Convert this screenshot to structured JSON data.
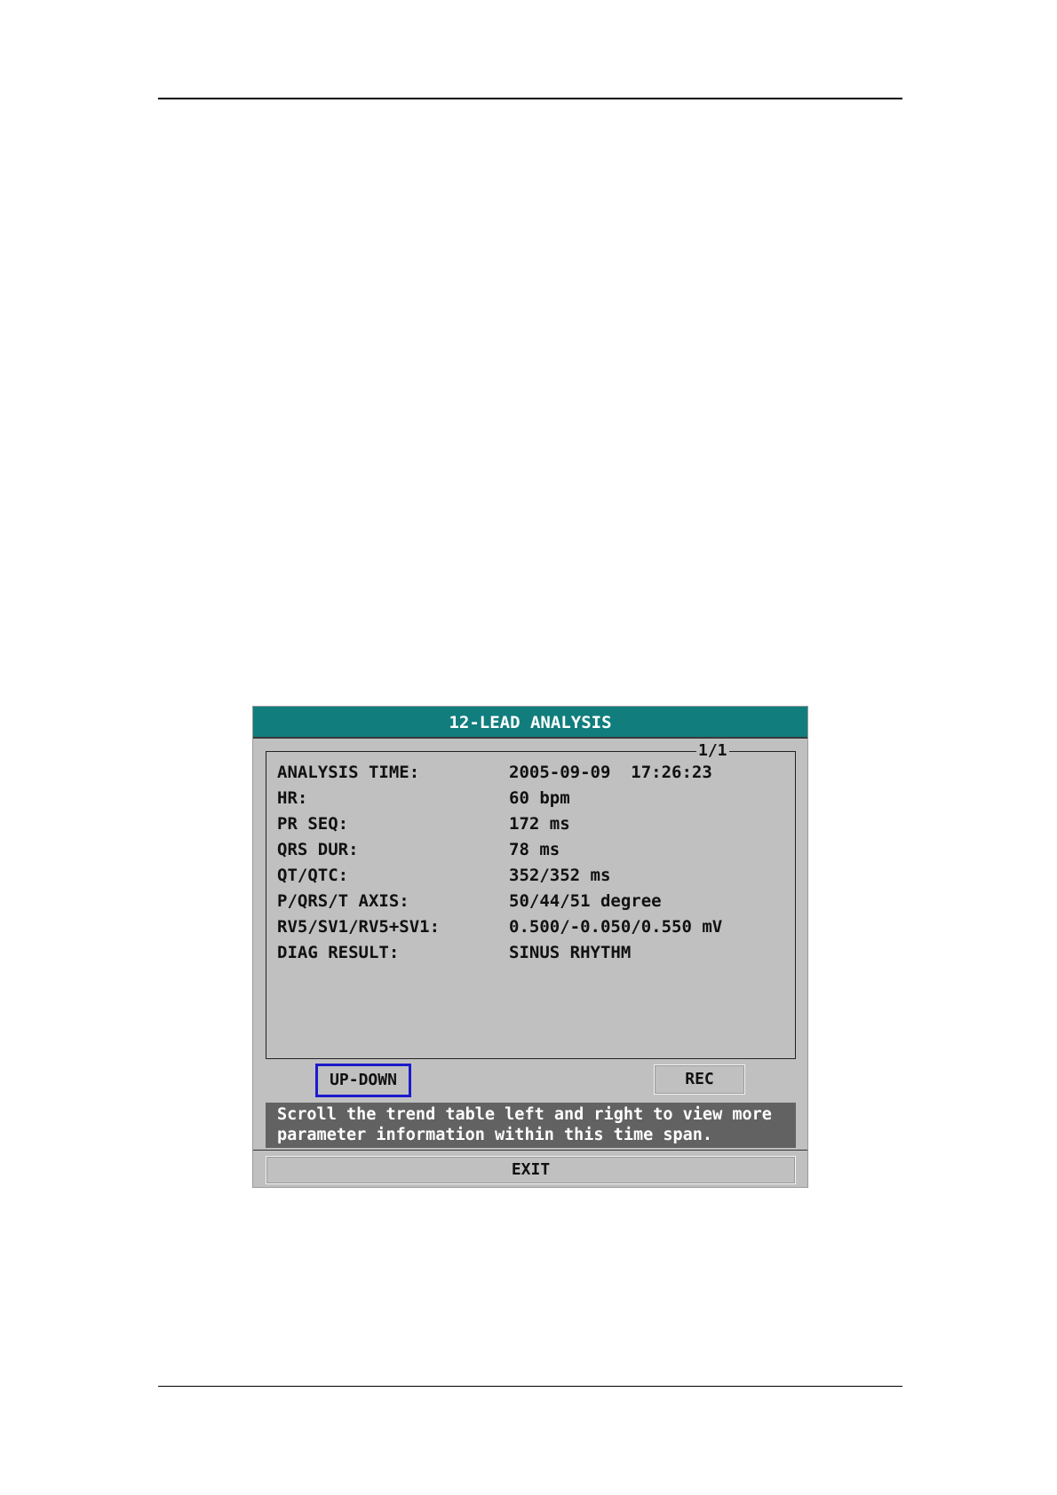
{
  "window": {
    "title": "12-LEAD ANALYSIS",
    "page_indicator": "1/1",
    "rows": [
      {
        "label": "ANALYSIS TIME:",
        "value": "2005-09-09  17:26:23"
      },
      {
        "label": "HR:",
        "value": "60 bpm"
      },
      {
        "label": "PR SEQ:",
        "value": "172 ms"
      },
      {
        "label": "QRS DUR:",
        "value": "78 ms"
      },
      {
        "label": "QT/QTC:",
        "value": "352/352 ms"
      },
      {
        "label": "P/QRS/T AXIS:",
        "value": "50/44/51 degree"
      },
      {
        "label": "RV5/SV1/RV5+SV1:",
        "value": "0.500/-0.050/0.550 mV"
      },
      {
        "label": "DIAG RESULT:",
        "value": "SINUS RHYTHM"
      }
    ],
    "buttons": {
      "updown": "UP-DOWN",
      "rec": "REC",
      "exit": "EXIT"
    },
    "help_lines": [
      "Scroll the trend table left and right to view more",
      "parameter information within this time span."
    ],
    "colors": {
      "titlebar": "#117d7d",
      "window_bg": "#c0c0c0",
      "help_bg": "#626262",
      "focus_border": "#1b1bcc"
    }
  }
}
